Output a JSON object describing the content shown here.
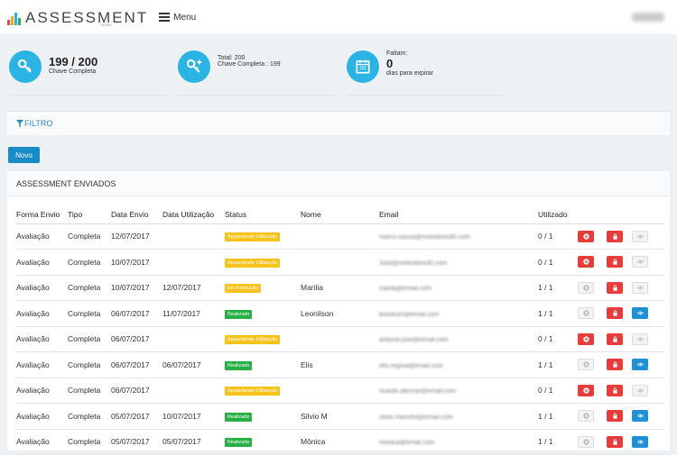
{
  "header": {
    "logo_text": "ASSESSMENT",
    "logo_sub": "MOBO",
    "menu_label": "Menu",
    "logo_colors": [
      "#e84c3d",
      "#f5a623",
      "#2bb3e3",
      "#27ae60"
    ]
  },
  "stats": [
    {
      "icon": "key-icon",
      "line1": "199 / 200",
      "line2": "Chave Completa"
    },
    {
      "icon": "key-plus-icon",
      "line1": "Total: 200",
      "line2": "Chave Completa : 199"
    },
    {
      "icon": "calendar-icon",
      "line0": "Faltam:",
      "line1": "0",
      "line2": "dias para expirar"
    }
  ],
  "filter": {
    "label": "FILTRO"
  },
  "new_button": {
    "label": "Novo"
  },
  "panel": {
    "title": "ASSESSMENT ENVIADOS"
  },
  "table": {
    "headers": [
      "Forma Envio",
      "Tipo",
      "Data Envio",
      "Data Utilização",
      "Status",
      "Nome",
      "Email",
      "Utilizado"
    ],
    "rows": [
      {
        "forma": "Avaliação",
        "tipo": "Completa",
        "envio": "12/07/2017",
        "util": "",
        "status": "Aguardando Utilização",
        "nome": "",
        "email": "marco.souza@metodomi30.com",
        "usado": "0 / 1",
        "a1": "red",
        "a2": "red",
        "a3": "grey"
      },
      {
        "forma": "Avaliação",
        "tipo": "Completa",
        "envio": "10/07/2017",
        "util": "",
        "status": "Aguardando Utilização",
        "nome": "",
        "email": "Julia@metodomi30.com",
        "usado": "0 / 1",
        "a1": "red",
        "a2": "red",
        "a3": "grey"
      },
      {
        "forma": "Avaliação",
        "tipo": "Completa",
        "envio": "10/07/2017",
        "util": "12/07/2017",
        "status": "Em Execução",
        "nome": "Marilia",
        "email": "marila@email.com",
        "usado": "1 / 1",
        "a1": "grey",
        "a2": "red",
        "a3": "grey"
      },
      {
        "forma": "Avaliação",
        "tipo": "Completa",
        "envio": "06/07/2017",
        "util": "11/07/2017",
        "status": "Realizado",
        "nome": "Leonilson",
        "email": "leonilson@email.com",
        "usado": "1 / 1",
        "a1": "grey",
        "a2": "red",
        "a3": "blue"
      },
      {
        "forma": "Avaliação",
        "tipo": "Completa",
        "envio": "06/07/2017",
        "util": "",
        "status": "Aguardando Utilização",
        "nome": "",
        "email": "antonio.jose@email.com",
        "usado": "0 / 1",
        "a1": "red",
        "a2": "red",
        "a3": "grey"
      },
      {
        "forma": "Avaliação",
        "tipo": "Completa",
        "envio": "06/07/2017",
        "util": "06/07/2017",
        "status": "Realizado",
        "nome": "Elis",
        "email": "elis.regina@email.com",
        "usado": "1 / 1",
        "a1": "grey",
        "a2": "red",
        "a3": "blue"
      },
      {
        "forma": "Avaliação",
        "tipo": "Completa",
        "envio": "06/07/2017",
        "util": "",
        "status": "Aguardando Utilização",
        "nome": "",
        "email": "ricardo.alencar@email.com",
        "usado": "0 / 1",
        "a1": "red",
        "a2": "red",
        "a3": "grey"
      },
      {
        "forma": "Avaliação",
        "tipo": "Completa",
        "envio": "05/07/2017",
        "util": "10/07/2017",
        "status": "Realizado",
        "nome": "Silvio M",
        "email": "silvio.marinho@email.com",
        "usado": "1 / 1",
        "a1": "grey",
        "a2": "red",
        "a3": "blue"
      },
      {
        "forma": "Avaliação",
        "tipo": "Completa",
        "envio": "05/07/2017",
        "util": "05/07/2017",
        "status": "Realizado",
        "nome": "Mônica",
        "email": "monica@email.com",
        "usado": "1 / 1",
        "a1": "grey",
        "a2": "red",
        "a3": "blue"
      }
    ]
  },
  "status_colors": {
    "Aguardando Utilização": "#f7c21b",
    "Em Execução": "#f7c21b",
    "Realizado": "#27ae44"
  }
}
